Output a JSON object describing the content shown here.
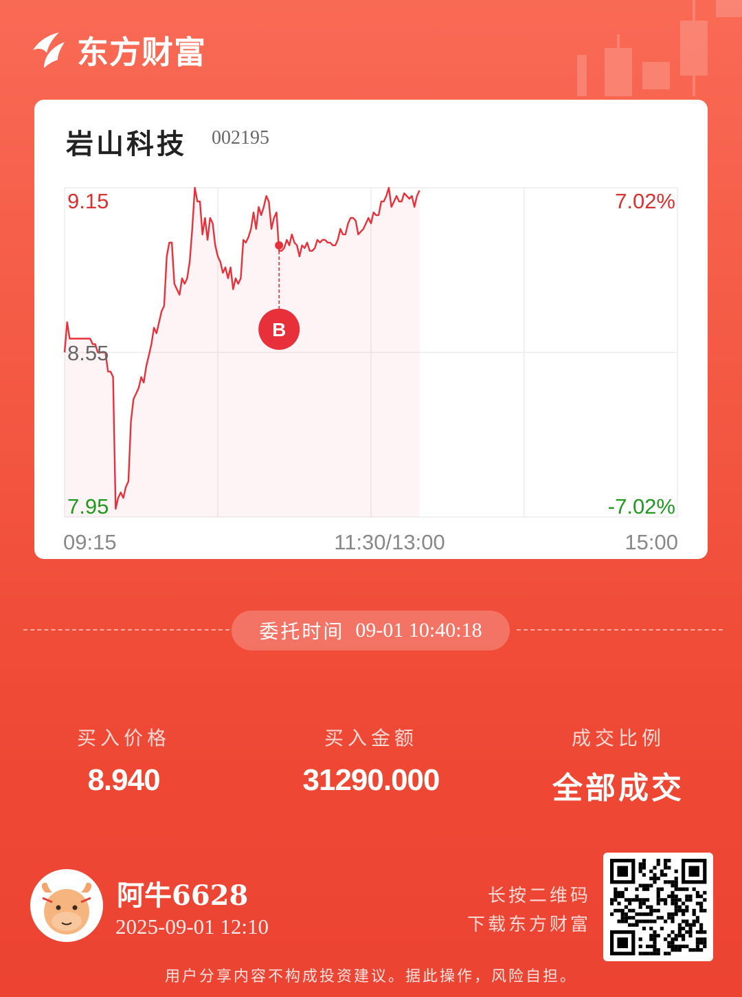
{
  "brand": {
    "name": "东方财富",
    "logo_icon": "eastmoney-logo-icon"
  },
  "stock": {
    "name": "岩山科技",
    "code": "002195"
  },
  "chart_data": {
    "type": "line",
    "title": "",
    "price_high": "9.15",
    "price_base": "8.55",
    "price_low": "7.95",
    "pct_high": "7.02%",
    "pct_low": "-7.02%",
    "x_ticks": [
      "09:15",
      "11:30/13:00",
      "15:00"
    ],
    "ylim": [
      7.95,
      9.15
    ],
    "colors": {
      "line": "#e8303a",
      "up": "#d93030",
      "down": "#1f9a1f",
      "base": "#666666"
    },
    "marker": {
      "label": "B",
      "time_index": 84,
      "price": 8.94
    },
    "series": [
      {
        "values": [
          8.55,
          8.66,
          8.6,
          8.6,
          8.6,
          8.6,
          8.6,
          8.6,
          8.6,
          8.6,
          8.6,
          8.58,
          8.58,
          8.55,
          8.55,
          8.55,
          8.55,
          8.48,
          8.48,
          8.46,
          7.98,
          8.02,
          8.04,
          8.02,
          8.06,
          8.08,
          8.3,
          8.38,
          8.4,
          8.42,
          8.46,
          8.44,
          8.5,
          8.54,
          8.58,
          8.64,
          8.62,
          8.66,
          8.7,
          8.72,
          8.9,
          8.95,
          8.95,
          8.8,
          8.78,
          8.76,
          8.82,
          8.8,
          8.82,
          8.88,
          9.0,
          9.15,
          9.1,
          9.1,
          8.98,
          9.04,
          8.96,
          9.04,
          9.02,
          8.94,
          8.9,
          8.88,
          8.84,
          8.86,
          8.82,
          8.86,
          8.78,
          8.82,
          8.8,
          8.82,
          8.96,
          8.95,
          8.97,
          9.0,
          9.06,
          9.0,
          9.08,
          9.05,
          9.08,
          9.12,
          9.1,
          9.0,
          9.04,
          9.06,
          8.92,
          8.92,
          8.93,
          8.96,
          8.94,
          8.98,
          8.95,
          8.94,
          8.9,
          8.94,
          8.93,
          8.95,
          8.92,
          8.92,
          8.93,
          8.96,
          8.95,
          8.96,
          8.96,
          8.95,
          8.95,
          8.94,
          8.94,
          8.96,
          9.0,
          8.98,
          8.98,
          9.02,
          9.04,
          9.04,
          9.03,
          8.98,
          8.99,
          9.0,
          9.02,
          9.04,
          9.02,
          9.06,
          9.05,
          9.05,
          9.1,
          9.1,
          9.12,
          9.15,
          9.08,
          9.1,
          9.12,
          9.1,
          9.1,
          9.13,
          9.12,
          9.11,
          9.12,
          9.08,
          9.12,
          9.14
        ]
      }
    ]
  },
  "order": {
    "time_label": "委托时间",
    "time_value": "09-01 10:40:18"
  },
  "stats": [
    {
      "label": "买入价格",
      "value": "8.940"
    },
    {
      "label": "买入金额",
      "value": "31290.000"
    },
    {
      "label": "成交比例",
      "value": "全部成交"
    }
  ],
  "user": {
    "name": "阿牛6628",
    "time": "2025-09-01 12:10",
    "avatar_icon": "cartoon-bull-icon"
  },
  "qr": {
    "hint_line1": "长按二维码",
    "hint_line2": "下载东方财富"
  },
  "disclaimer": "用户分享内容不构成投资建议。据此操作，风险自担。"
}
